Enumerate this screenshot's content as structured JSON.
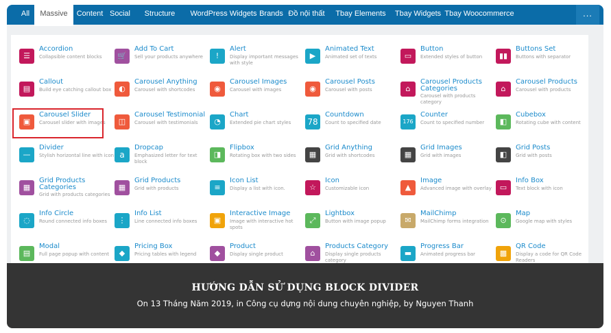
{
  "tabs": [
    "All",
    "Massive",
    "Content",
    "Social",
    "Structure",
    "WordPress Widgets",
    "Brands",
    "Đồ nội thất",
    "Tbay Elements",
    "Tbay Widgets",
    "Tbay Woocommerce"
  ],
  "more_label": "...",
  "active_tab": "Massive",
  "elements": [
    {
      "name": "Accordion",
      "desc": "Collapsible content blocks",
      "icon": "accordion-icon",
      "color": "#c2185b"
    },
    {
      "name": "Add To Cart",
      "desc": "Sell your products anywhere",
      "icon": "cart-icon",
      "color": "#a0509f"
    },
    {
      "name": "Alert",
      "desc": "Display important messages with style",
      "icon": "alert-icon",
      "color": "#1ba6c7"
    },
    {
      "name": "Animated Text",
      "desc": "Animated set of texts",
      "icon": "animated-text-icon",
      "color": "#1ba6c7"
    },
    {
      "name": "Button",
      "desc": "Extended styles of button",
      "icon": "button-icon",
      "color": "#c2185b"
    },
    {
      "name": "Buttons Set",
      "desc": "Buttons with separator",
      "icon": "buttons-set-icon",
      "color": "#c2185b"
    },
    {
      "name": "Callout",
      "desc": "Build eye catching callout box",
      "icon": "callout-icon",
      "color": "#c2185b"
    },
    {
      "name": "Carousel Anything",
      "desc": "Carousel with shortcodes",
      "icon": "carousel-icon",
      "color": "#ef5a3c"
    },
    {
      "name": "Carousel Images",
      "desc": "Carousel with images",
      "icon": "carousel-images-icon",
      "color": "#ef5a3c"
    },
    {
      "name": "Carousel Posts",
      "desc": "Carousel with posts",
      "icon": "carousel-posts-icon",
      "color": "#ef5a3c"
    },
    {
      "name": "Carousel Products Categories",
      "desc": "Carousel with products category",
      "icon": "carousel-categories-icon",
      "color": "#c2185b"
    },
    {
      "name": "Carousel Products",
      "desc": "Carousel with products",
      "icon": "carousel-products-icon",
      "color": "#c2185b"
    },
    {
      "name": "Carousel Slider",
      "desc": "Carousel slider with images",
      "icon": "carousel-slider-icon",
      "color": "#ef5a3c"
    },
    {
      "name": "Carousel Testimonial",
      "desc": "Carousel with testimonials",
      "icon": "testimonial-icon",
      "color": "#ef5a3c"
    },
    {
      "name": "Chart",
      "desc": "Extended pie chart styles",
      "icon": "chart-icon",
      "color": "#1ba6c7"
    },
    {
      "name": "Countdown",
      "desc": "Count to specified date",
      "icon": "countdown-icon",
      "glyph": "78",
      "color": "#1ba6c7"
    },
    {
      "name": "Counter",
      "desc": "Count to specified number",
      "icon": "counter-icon",
      "glyph": "176",
      "color": "#1ba6c7"
    },
    {
      "name": "Cubebox",
      "desc": "Rotating cube with content",
      "icon": "cubebox-icon",
      "color": "#5cb85c"
    },
    {
      "name": "Divider",
      "desc": "Stylish horizontal line with icon",
      "icon": "divider-icon",
      "color": "#1ba6c7"
    },
    {
      "name": "Dropcap",
      "desc": "Emphasized letter for text block",
      "icon": "dropcap-icon",
      "glyph": "a",
      "color": "#1ba6c7"
    },
    {
      "name": "Flipbox",
      "desc": "Rotating box with two sides",
      "icon": "flipbox-icon",
      "color": "#5cb85c"
    },
    {
      "name": "Grid Anything",
      "desc": "Grid with shortcodes",
      "icon": "grid-icon",
      "color": "#444"
    },
    {
      "name": "Grid Images",
      "desc": "Grid with images",
      "icon": "grid-images-icon",
      "color": "#444"
    },
    {
      "name": "Grid Posts",
      "desc": "Grid with posts",
      "icon": "grid-posts-icon",
      "color": "#444"
    },
    {
      "name": "Grid Products Categories",
      "desc": "Grid with products categories",
      "icon": "grid-categories-icon",
      "color": "#a0509f"
    },
    {
      "name": "Grid Products",
      "desc": "Grid with products",
      "icon": "grid-products-icon",
      "color": "#a0509f"
    },
    {
      "name": "Icon List",
      "desc": "Display a list with icon.",
      "icon": "icon-list-icon",
      "color": "#1ba6c7"
    },
    {
      "name": "Icon",
      "desc": "Customizable icon",
      "icon": "star-icon",
      "color": "#c2185b"
    },
    {
      "name": "Image",
      "desc": "Advanced image with overlay",
      "icon": "image-icon",
      "color": "#ef5a3c"
    },
    {
      "name": "Info Box",
      "desc": "Text block with icon",
      "icon": "info-box-icon",
      "color": "#c2185b"
    },
    {
      "name": "Info Circle",
      "desc": "Round connected info boxes",
      "icon": "info-circle-icon",
      "color": "#1ba6c7"
    },
    {
      "name": "Info List",
      "desc": "Line connected info boxes",
      "icon": "info-list-icon",
      "color": "#1ba6c7"
    },
    {
      "name": "Interactive Image",
      "desc": "Image with interactive hot spots",
      "icon": "interactive-image-icon",
      "color": "#f0a30a"
    },
    {
      "name": "Lightbox",
      "desc": "Button with image popup",
      "icon": "lightbox-icon",
      "color": "#5cb85c"
    },
    {
      "name": "MailChimp",
      "desc": "MailChimp forms integration",
      "icon": "mailchimp-icon",
      "color": "#c8a96a"
    },
    {
      "name": "Map",
      "desc": "Google map with styles",
      "icon": "map-pin-icon",
      "color": "#5cb85c"
    },
    {
      "name": "Modal",
      "desc": "Full page popup with content",
      "icon": "modal-icon",
      "color": "#5cb85c"
    },
    {
      "name": "Pricing Box",
      "desc": "Pricing tables with legend",
      "icon": "pricing-tag-icon",
      "color": "#1ba6c7"
    },
    {
      "name": "Product",
      "desc": "Display single product",
      "icon": "product-tag-icon",
      "color": "#a0509f"
    },
    {
      "name": "Products Category",
      "desc": "Display single products category",
      "icon": "products-category-icon",
      "color": "#a0509f"
    },
    {
      "name": "Progress Bar",
      "desc": "Animated progress bar",
      "icon": "progress-bar-icon",
      "color": "#1ba6c7"
    },
    {
      "name": "QR Code",
      "desc": "Display a code for QR Code Readers",
      "icon": "qr-code-icon",
      "color": "#f0a30a"
    }
  ],
  "post": {
    "title": "HƯỚNG DẪN SỬ DỤNG BLOCK DIVIDER",
    "meta": "On 13 Tháng Năm 2019, in Công cụ dựng nội dung chuyên nghiệp, by Nguyen Thanh"
  }
}
